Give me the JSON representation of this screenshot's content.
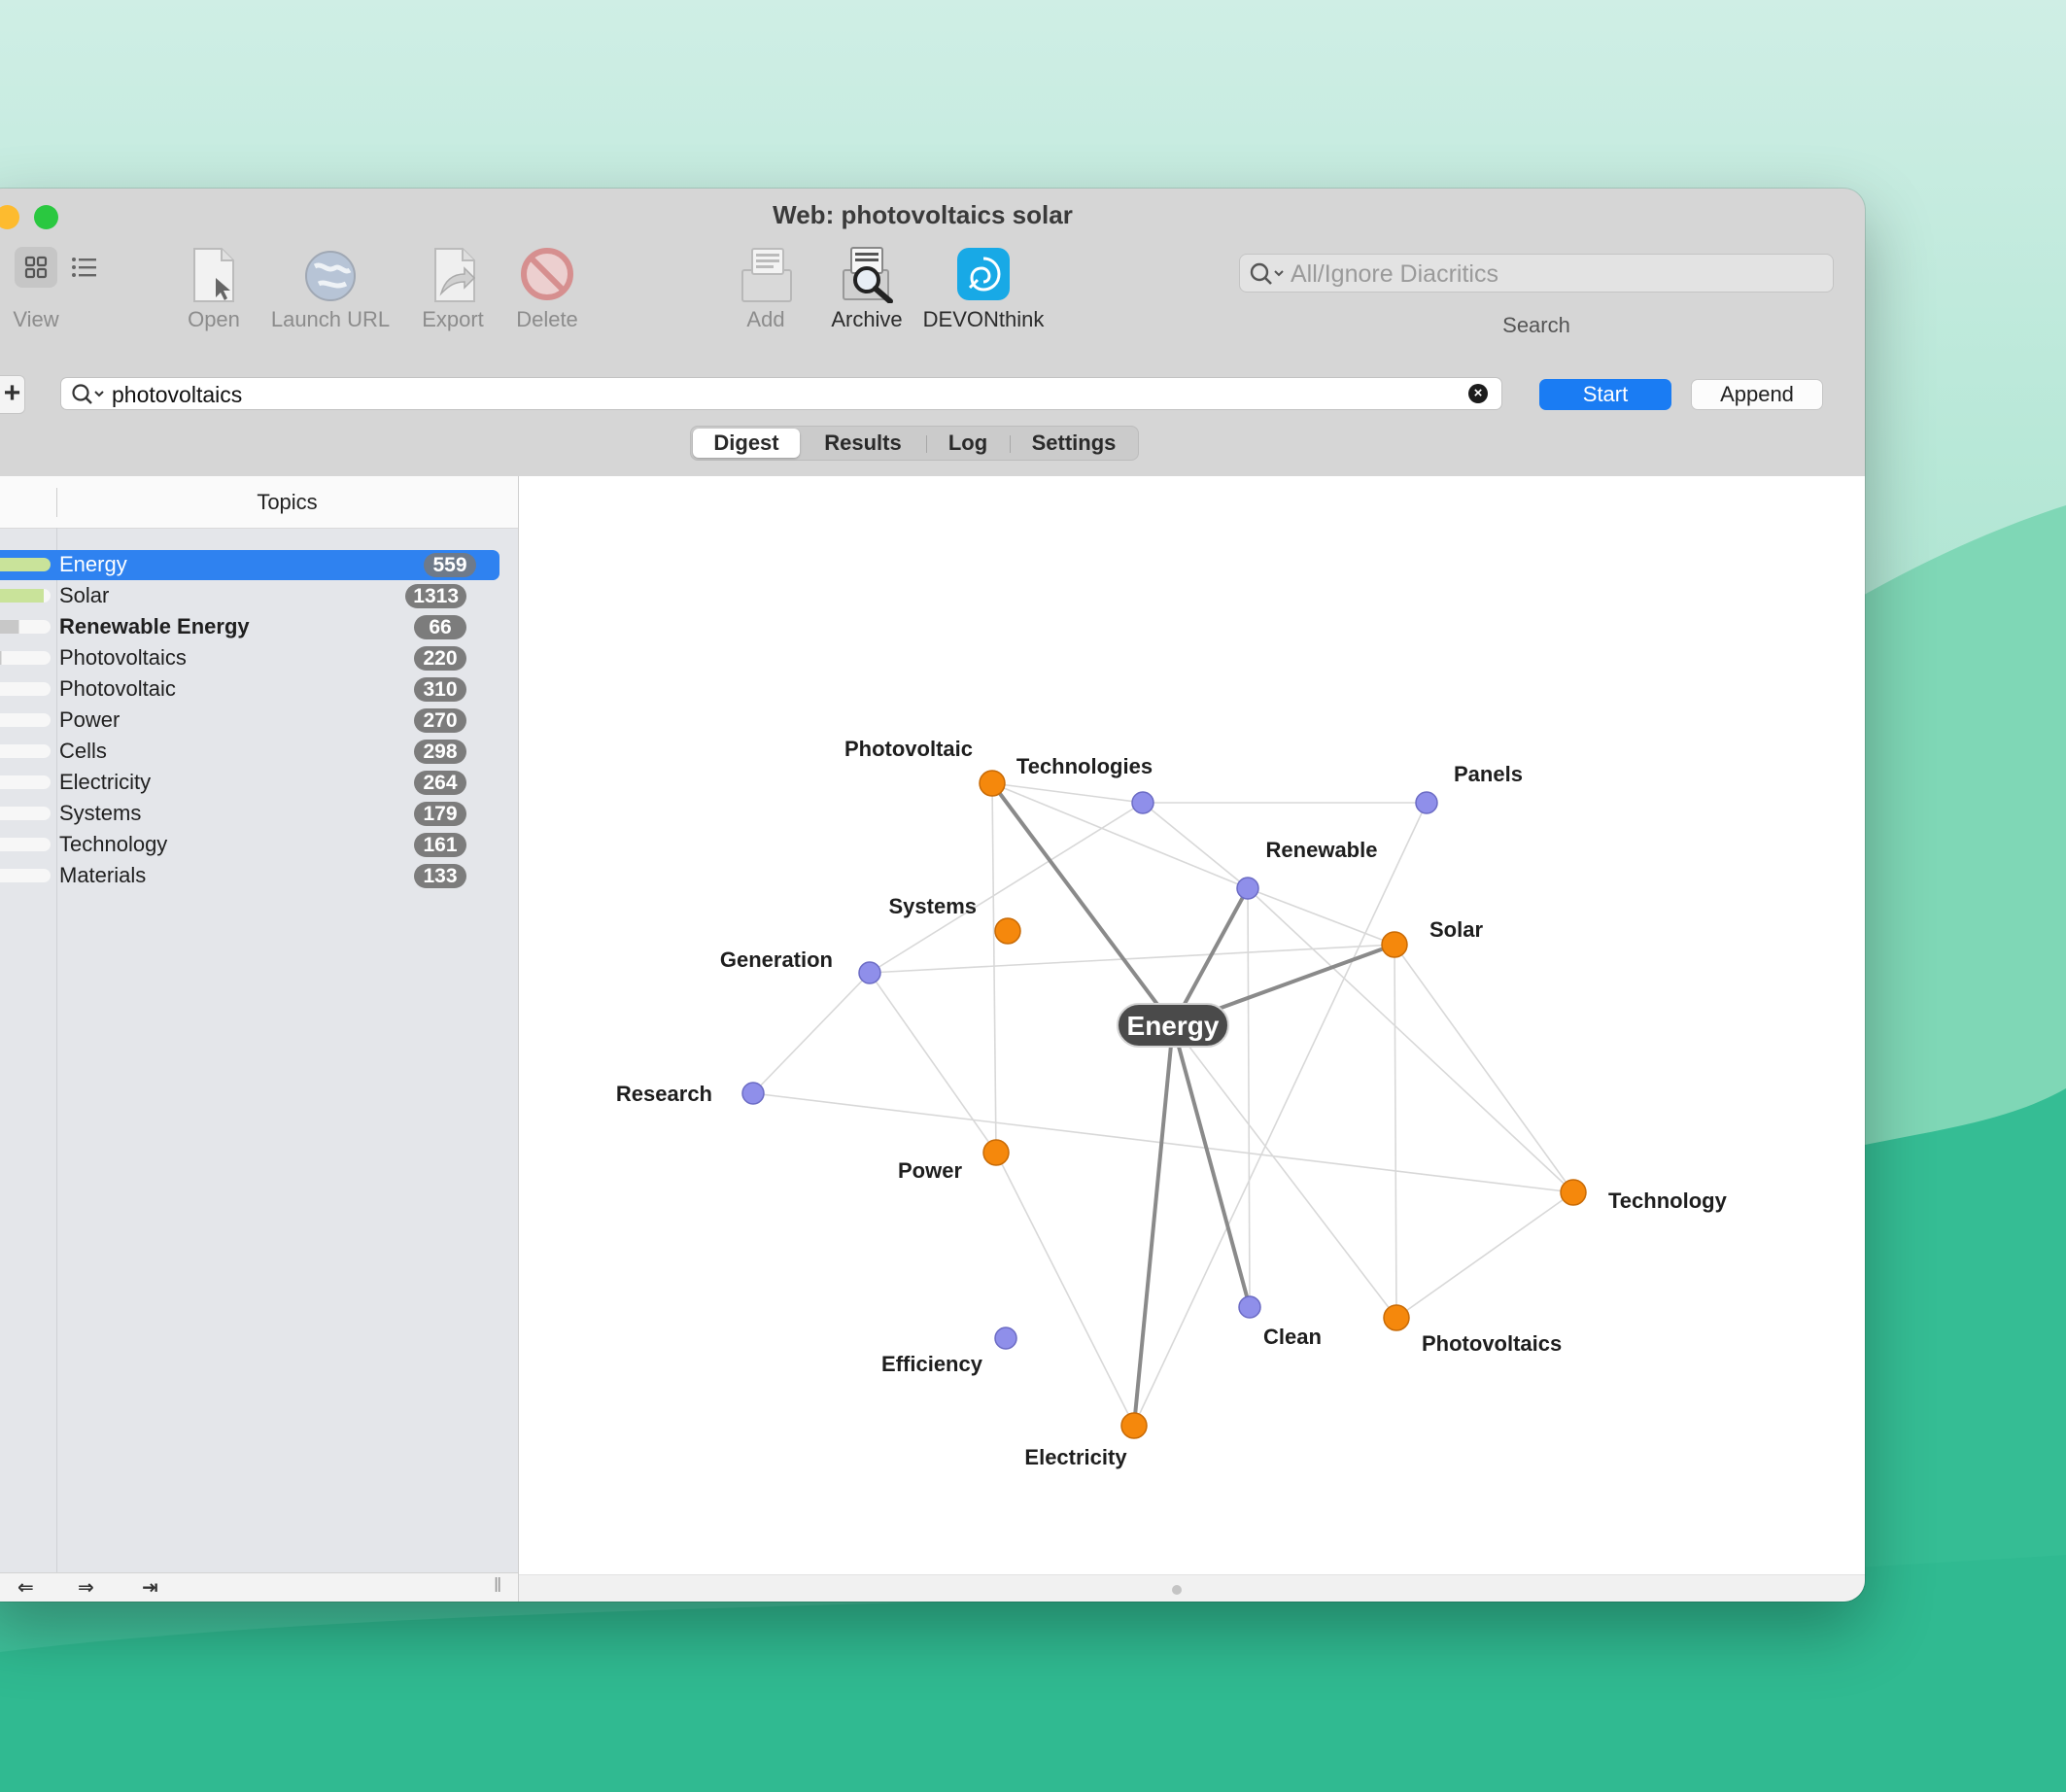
{
  "window": {
    "title": "Web: photovoltaics solar"
  },
  "toolbar": {
    "view_label": "View",
    "open_label": "Open",
    "launch_url_label": "Launch URL",
    "export_label": "Export",
    "delete_label": "Delete",
    "add_label": "Add",
    "archive_label": "Archive",
    "devonthink_label": "DEVONthink",
    "search_label": "Search",
    "search_placeholder": "All/Ignore Diacritics"
  },
  "query": {
    "value": "photovoltaics",
    "start_label": "Start",
    "append_label": "Append"
  },
  "tabs": [
    {
      "label": "Digest"
    },
    {
      "label": "Results"
    },
    {
      "label": "Log"
    },
    {
      "label": "Settings"
    }
  ],
  "sidebar": {
    "heading": "Topics",
    "items": [
      {
        "label": "Energy",
        "count": "559",
        "bar": 1.0
      },
      {
        "label": "Solar",
        "count": "1313",
        "bar": 0.9
      },
      {
        "label": "Renewable Energy",
        "count": "66",
        "bar": 0.55
      },
      {
        "label": "Photovoltaics",
        "count": "220",
        "bar": 0.3
      },
      {
        "label": "Photovoltaic",
        "count": "310",
        "bar": 0.25
      },
      {
        "label": "Power",
        "count": "270",
        "bar": 0.22
      },
      {
        "label": "Cells",
        "count": "298",
        "bar": 0.2
      },
      {
        "label": "Electricity",
        "count": "264",
        "bar": 0.18
      },
      {
        "label": "Systems",
        "count": "179",
        "bar": 0.16
      },
      {
        "label": "Technology",
        "count": "161",
        "bar": 0.14
      },
      {
        "label": "Materials",
        "count": "133",
        "bar": 0.12
      }
    ]
  },
  "colors": {
    "accent": "#1a7cf3",
    "selection": "#2f82f0",
    "node_orange": "#f5880c",
    "node_purple": "#8f8fea",
    "bar_green": "#c9e39a",
    "bar_gray": "#c8c8c8"
  },
  "graph": {
    "center": "Energy",
    "nodes": [
      {
        "id": "Energy",
        "type": "center"
      },
      {
        "id": "Photovoltaic",
        "type": "orange"
      },
      {
        "id": "Technologies",
        "type": "purple"
      },
      {
        "id": "Panels",
        "type": "purple"
      },
      {
        "id": "Renewable",
        "type": "purple"
      },
      {
        "id": "Systems",
        "type": "orange"
      },
      {
        "id": "Solar",
        "type": "orange"
      },
      {
        "id": "Generation",
        "type": "purple"
      },
      {
        "id": "Research",
        "type": "purple"
      },
      {
        "id": "Power",
        "type": "orange"
      },
      {
        "id": "Technology",
        "type": "orange"
      },
      {
        "id": "Clean",
        "type": "purple"
      },
      {
        "id": "Photovoltaics",
        "type": "orange"
      },
      {
        "id": "Efficiency",
        "type": "purple"
      },
      {
        "id": "Electricity",
        "type": "orange"
      }
    ],
    "strong_edges": [
      [
        "Energy",
        "Photovoltaic"
      ],
      [
        "Energy",
        "Renewable"
      ],
      [
        "Energy",
        "Solar"
      ],
      [
        "Energy",
        "Electricity"
      ],
      [
        "Energy",
        "Clean"
      ]
    ],
    "weak_edges": [
      [
        "Photovoltaic",
        "Technologies"
      ],
      [
        "Photovoltaic",
        "Renewable"
      ],
      [
        "Photovoltaic",
        "Power"
      ],
      [
        "Technologies",
        "Panels"
      ],
      [
        "Technologies",
        "Renewable"
      ],
      [
        "Technologies",
        "Generation"
      ],
      [
        "Renewable",
        "Solar"
      ],
      [
        "Renewable",
        "Clean"
      ],
      [
        "Renewable",
        "Technology"
      ],
      [
        "Panels",
        "Electricity"
      ],
      [
        "Generation",
        "Solar"
      ],
      [
        "Generation",
        "Power"
      ],
      [
        "Generation",
        "Research"
      ],
      [
        "Research",
        "Technology"
      ],
      [
        "Solar",
        "Photovoltaics"
      ],
      [
        "Solar",
        "Technology"
      ],
      [
        "Power",
        "Electricity"
      ],
      [
        "Photovoltaics",
        "Technology"
      ],
      [
        "Photovoltaics",
        "Energy"
      ]
    ]
  }
}
